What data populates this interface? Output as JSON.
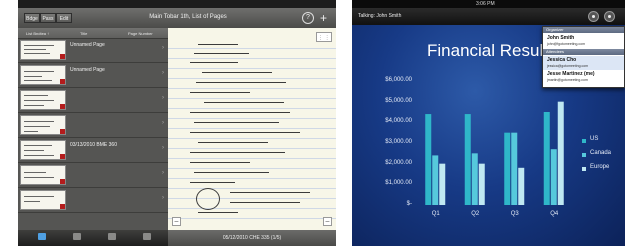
{
  "left_app": {
    "status_time": "",
    "nav": {
      "segments": [
        "Bdge",
        "Pass",
        "Edit"
      ],
      "title": "Main Tobar 1th, List of Pages",
      "help_label": "?",
      "add_label": "+"
    },
    "list_header": {
      "col1": "List Bndtea ↑",
      "col2": "Title",
      "col3": "Page Number"
    },
    "notebook_rows": [
      {
        "label": "Unnamed Page"
      },
      {
        "label": "Unnamed Page"
      },
      {
        "label": ""
      },
      {
        "label": ""
      },
      {
        "label": "03/13/2010 BME 360"
      },
      {
        "label": ""
      },
      {
        "label": ""
      }
    ],
    "note_toolbar_label": "⋮ ⋮",
    "footer_text": "05/12/2010 CHE 335  (1/5)",
    "minus_label": "–",
    "tab_icons": [
      "notebook-icon",
      "people-icon",
      "tag-icon",
      "settings-icon"
    ]
  },
  "right_app": {
    "status_time": "3:06 PM",
    "talking_label": "Talking: John Smith",
    "slide": {
      "title": "Financial Resul"
    },
    "popover": {
      "organizer_header": "Organizer",
      "organizer_name": "John Smith",
      "organizer_email": "john@fgotomeeting.com",
      "attendees_header": "Attendees",
      "attendees": [
        {
          "name": "Jessica Cho",
          "email": "jessica@gotomeeting.com"
        },
        {
          "name": "Jesse Martinez (me)",
          "email": "jmartin@gotomeeting.com"
        }
      ]
    }
  },
  "chart_data": {
    "type": "bar",
    "title": "Financial Resul",
    "categories": [
      "Q1",
      "Q2",
      "Q3",
      "Q4"
    ],
    "series": [
      {
        "name": "US",
        "values": [
          4400,
          4400,
          3500,
          4500
        ],
        "color": "#2fb7c9"
      },
      {
        "name": "Canada",
        "values": [
          2400,
          2500,
          3500,
          2700
        ],
        "color": "#56c9dc"
      },
      {
        "name": "Europe",
        "values": [
          2000,
          2000,
          1800,
          5000
        ],
        "color": "#bfe8f2"
      }
    ],
    "y_ticks": [
      "$6,000.00",
      "$5,000.00",
      "$4,000.00",
      "$3,000.00",
      "$2,000.00",
      "$1,000.00",
      "$-"
    ],
    "ylim": [
      0,
      6000
    ],
    "legend": "right"
  }
}
